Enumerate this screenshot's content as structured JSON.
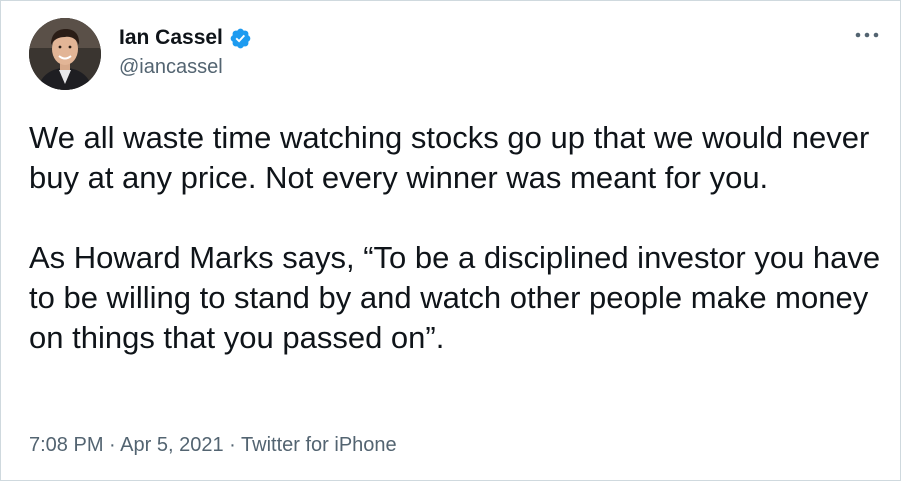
{
  "author": {
    "display_name": "Ian Cassel",
    "handle": "@iancassel",
    "verified_icon": "verified-badge-icon",
    "verified_color": "#1d9bf0"
  },
  "menu": {
    "icon": "more-options-icon"
  },
  "tweet": {
    "paragraph_1": "We all waste time watching stocks go up that we would never buy at any price. Not every winner was meant for you.",
    "paragraph_2": "As Howard Marks says, “To be a disciplined investor you have to be willing to stand by and watch other people make money on things that you passed on”."
  },
  "meta": {
    "time": "7:08 PM",
    "separator": "·",
    "date": "Apr 5, 2021",
    "source": "Twitter for iPhone"
  },
  "colors": {
    "text": "#0f1419",
    "secondary": "#536471",
    "border": "#cfd9de"
  }
}
